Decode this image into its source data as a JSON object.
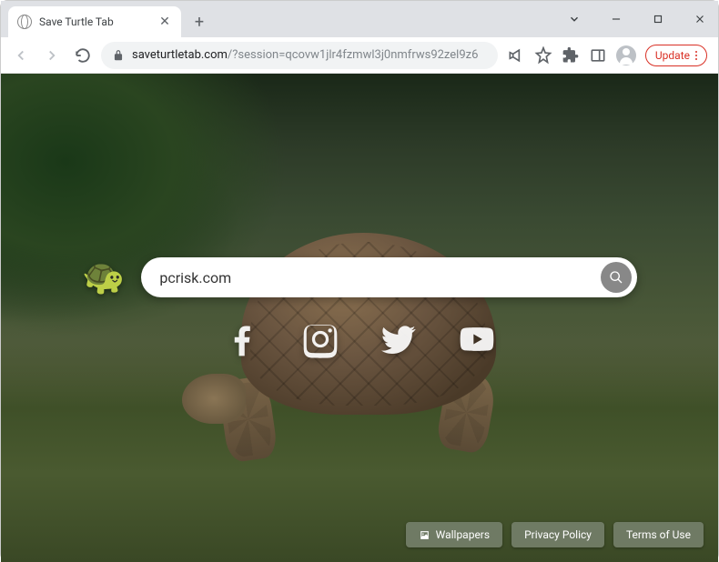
{
  "browser": {
    "tab_title": "Save Turtle Tab",
    "update_label": "Update",
    "address": {
      "domain": "saveturtletab.com",
      "path": "/?session=qcovw1jlr4fzmwl3j0nmfrws92zel9z6"
    }
  },
  "page": {
    "logo_emoji": "🐢",
    "search_value": "pcrisk.com",
    "social": {
      "facebook": "facebook-icon",
      "instagram": "instagram-icon",
      "twitter": "twitter-icon",
      "youtube": "youtube-icon"
    },
    "footer": {
      "wallpapers": "Wallpapers",
      "privacy": "Privacy Policy",
      "terms": "Terms of Use"
    }
  }
}
